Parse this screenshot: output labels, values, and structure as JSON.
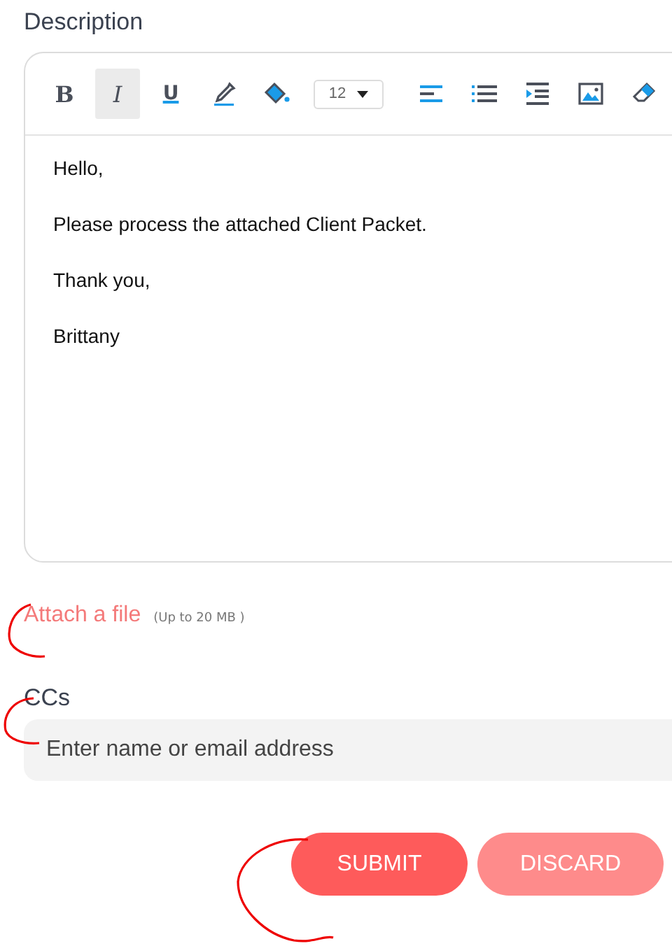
{
  "description_label": "Description",
  "toolbar": [
    {
      "kind": "bold",
      "label": "B",
      "selected": false
    },
    {
      "kind": "italic",
      "label": "I",
      "selected": true
    },
    {
      "kind": "underline",
      "label": "U",
      "selected": false
    },
    {
      "kind": "text-color",
      "selected": false
    },
    {
      "kind": "fill-color",
      "selected": false
    },
    {
      "kind": "font-size",
      "label": "12",
      "selected": false
    },
    {
      "kind": "align-left",
      "selected": false
    },
    {
      "kind": "list",
      "selected": false
    },
    {
      "kind": "indent",
      "selected": false
    },
    {
      "kind": "image",
      "selected": false
    },
    {
      "kind": "eraser",
      "selected": false
    }
  ],
  "body": [
    "Hello,",
    "Please process the attached Client Packet.",
    "Thank you,",
    "Brittany"
  ],
  "attach": {
    "link": "Attach a file",
    "note": "(Up to 20 MB )"
  },
  "ccs": {
    "label": "CCs",
    "placeholder": "Enter name or email address"
  },
  "buttons": [
    {
      "kind": "primary",
      "label": "SUBMIT"
    },
    {
      "kind": "secondary",
      "label": "DISCARD"
    }
  ]
}
